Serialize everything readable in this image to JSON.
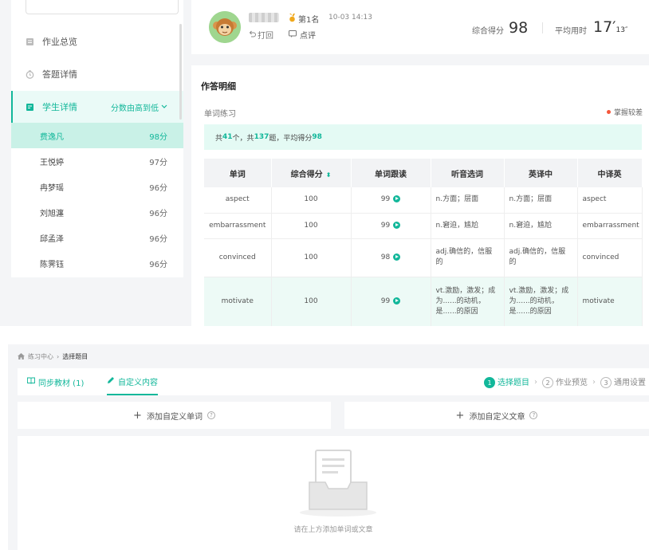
{
  "sidebar": {
    "nav": [
      {
        "label": "作业总览"
      },
      {
        "label": "答题详情"
      },
      {
        "label": "学生详情",
        "sort": "分数由高到低"
      }
    ],
    "students": [
      {
        "name": "费逸凡",
        "score": "98分"
      },
      {
        "name": "王悦婷",
        "score": "97分"
      },
      {
        "name": "冉梦瑶",
        "score": "96分"
      },
      {
        "name": "刘旭瀍",
        "score": "96分"
      },
      {
        "name": "邱孟泽",
        "score": "96分"
      },
      {
        "name": "陈霁钰",
        "score": "96分"
      }
    ]
  },
  "header": {
    "rank": "第1名",
    "date": "10-03 14:13",
    "back": "打回",
    "comment": "点评",
    "score_label": "综合得分",
    "score_value": "98",
    "time_label": "平均用时",
    "time_min": "17′",
    "time_sec": "13″"
  },
  "detail": {
    "title": "作答明细",
    "section": "单词练习",
    "legend": "掌握较差",
    "summary": {
      "pre": "共",
      "count": "41",
      "mid1": "个，共",
      "questions": "137",
      "mid2": "题，平均得分",
      "avg": "98"
    },
    "columns": [
      "单词",
      "综合得分",
      "单词跟读",
      "听音选词",
      "英译中",
      "中译英"
    ],
    "rows": [
      {
        "word": "aspect",
        "score": "100",
        "follow": "99",
        "listen": "n.方面；层面",
        "en_cn": "n.方面；层面",
        "cn_en": "aspect"
      },
      {
        "word": "embarrassment",
        "score": "100",
        "follow": "99",
        "listen": "n.窘迫，尴尬",
        "en_cn": "n.窘迫，尴尬",
        "cn_en": "embarrassment"
      },
      {
        "word": "convinced",
        "score": "100",
        "follow": "98",
        "listen": "adj.确信的，信服的",
        "en_cn": "adj.确信的，信服的",
        "cn_en": "convinced"
      },
      {
        "word": "motivate",
        "score": "100",
        "follow": "99",
        "listen": "vt.激励，激发；成为......的动机，是......的原因",
        "en_cn": "vt.激励，激发；成为......的动机，是......的原因",
        "cn_en": "motivate"
      }
    ]
  },
  "bottom": {
    "breadcrumb": {
      "home": "练习中心",
      "current": "选择题目"
    },
    "tabs": [
      {
        "label": "同步教材 (1)"
      },
      {
        "label": "自定义内容"
      }
    ],
    "steps": [
      {
        "num": "1",
        "label": "选择题目"
      },
      {
        "num": "2",
        "label": "作业预览"
      },
      {
        "num": "3",
        "label": "通用设置"
      }
    ],
    "add_word": "添加自定义单词",
    "add_article": "添加自定义文章",
    "empty_text": "请在上方添加单词或文章"
  },
  "colors": {
    "accent": "#12b79a",
    "warn_dot": "#f5573b"
  }
}
